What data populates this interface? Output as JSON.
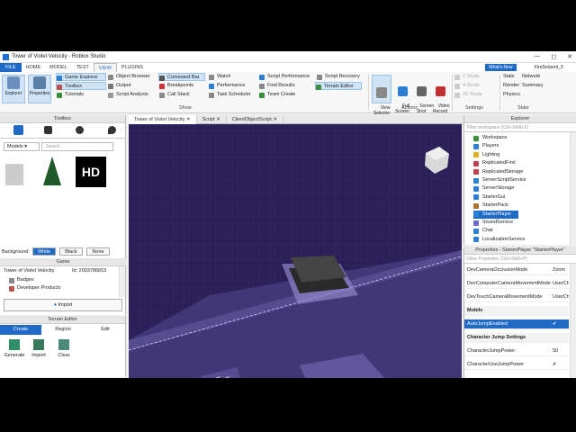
{
  "window": {
    "title": "Tower of Violet Velocity - Roblox Studio",
    "min": "—",
    "max": "◻",
    "close": "✕"
  },
  "menu": {
    "file": "FILE",
    "tabs": [
      "HOME",
      "MODEL",
      "TEST",
      "VIEW",
      "PLUGINS"
    ],
    "active_tab": "VIEW",
    "whats_new": "What's New",
    "user": "FireSerpent_9"
  },
  "ribbon": {
    "explorer": "Explorer",
    "properties": "Properties",
    "col1": [
      "Game Explorer",
      "Toolbox",
      "Tutorials"
    ],
    "col2": [
      "Object Browser",
      "Output",
      "Script Analysis"
    ],
    "col3": [
      "Command Bar",
      "Breakpoints",
      "Call Stack"
    ],
    "col4": [
      "Watch",
      "Performance",
      "Task Scheduler"
    ],
    "col5": [
      "Script Performance",
      "Find Results",
      "Team Create"
    ],
    "col6": [
      "Script Recovery",
      "Terrain Editor"
    ],
    "show_label": "Show",
    "view_selector": "View\nSelector",
    "full_screen": "Full\nScreen",
    "screen_shot": "Screen\nShot",
    "video_record": "Video\nRecord",
    "actions_label": "Actions",
    "studs": [
      "2 Studs",
      "4 Studs",
      "16 Studs"
    ],
    "settings_label": "Settings",
    "stats": [
      "Stats",
      "Render",
      "Physics"
    ],
    "stats2": [
      "Network",
      "Summary"
    ],
    "stats_label": "Stats"
  },
  "toolbox": {
    "title": "Toolbox",
    "category": "Models",
    "search_placeholder": "Search",
    "background_label": "Background:",
    "bg_options": [
      "White",
      "Black",
      "None"
    ],
    "game_label": "Game",
    "game_name": "Tower of Violet Velocity",
    "game_id": "Id: 2003786653",
    "items": [
      "Badges",
      "Developer Products"
    ],
    "import_label": "Import"
  },
  "terrain": {
    "title": "Terrain Editor",
    "tabs": [
      "Create",
      "Region",
      "Edit"
    ],
    "tools": [
      "Generate",
      "Import",
      "Clear"
    ]
  },
  "doctabs": [
    "Tower of Violet Velocity",
    "Script",
    "ClientObjectScript"
  ],
  "explorer": {
    "title": "Explorer",
    "filter": "Filter workspace (Ctrl+Shift+X)",
    "items": [
      {
        "label": "Workspace",
        "color": "#3a8f3a"
      },
      {
        "label": "Players",
        "color": "#2a7fd4"
      },
      {
        "label": "Lighting",
        "color": "#e0b020"
      },
      {
        "label": "ReplicatedFirst",
        "color": "#c04050"
      },
      {
        "label": "ReplicatedStorage",
        "color": "#c04050"
      },
      {
        "label": "ServerScriptService",
        "color": "#2a7fd4"
      },
      {
        "label": "ServerStorage",
        "color": "#2a7fd4"
      },
      {
        "label": "StarterGui",
        "color": "#2a7fd4"
      },
      {
        "label": "StarterPack",
        "color": "#b07030"
      },
      {
        "label": "StarterPlayer",
        "color": "#2a7fd4"
      },
      {
        "label": "SoundService",
        "color": "#6a6ad0"
      },
      {
        "label": "Chat",
        "color": "#2a7fd4"
      },
      {
        "label": "LocalizationService",
        "color": "#2a7fd4"
      }
    ],
    "selected": "StarterPlayer"
  },
  "properties": {
    "title": "Properties - StarterPlayer \"StarterPlayer\"",
    "filter": "Filter Properties (Ctrl+Shift+P)",
    "rows": [
      {
        "name": "DevCameraOcclusionMode",
        "value": "Zoom",
        "kind": "row"
      },
      {
        "name": "DevComputerCameraMovementMode",
        "value": "UserCh",
        "kind": "row"
      },
      {
        "name": "DevTouchCameraMovementMode",
        "value": "UserCh",
        "kind": "row"
      },
      {
        "name": "Mobile",
        "value": "",
        "kind": "cat"
      },
      {
        "name": "AutoJumpEnabled",
        "value": "✔",
        "kind": "sel"
      },
      {
        "name": "Character Jump Settings",
        "value": "",
        "kind": "cat"
      },
      {
        "name": "CharacterJumpPower",
        "value": "50",
        "kind": "row"
      },
      {
        "name": "CharacterUseJumpPower",
        "value": "✔",
        "kind": "row"
      }
    ]
  },
  "colors": {
    "accent": "#1f6ac7",
    "viewport": "#2b1f57"
  }
}
